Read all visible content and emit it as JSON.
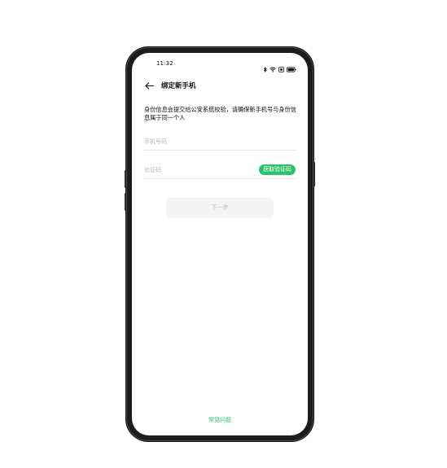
{
  "status_bar": {
    "time": "11:32",
    "icons": [
      "bluetooth-icon",
      "wifi-icon",
      "sim-icon",
      "battery-icon"
    ]
  },
  "header": {
    "title": "绑定新手机"
  },
  "description": "身份信息会提交给公安系统校验，请确保新手机号与身份信息属于同一个人",
  "form": {
    "phone_placeholder": "手机号码",
    "phone_value": "",
    "code_placeholder": "验证码",
    "code_value": "",
    "get_code_label": "获取验证码",
    "next_label": "下一步"
  },
  "footer": {
    "faq_label": "常见问题"
  },
  "colors": {
    "accent": "#2ec26a",
    "disabled_button_bg": "#f3f4f6",
    "disabled_button_text": "#b9b9b9",
    "placeholder": "#b6b6b6"
  }
}
